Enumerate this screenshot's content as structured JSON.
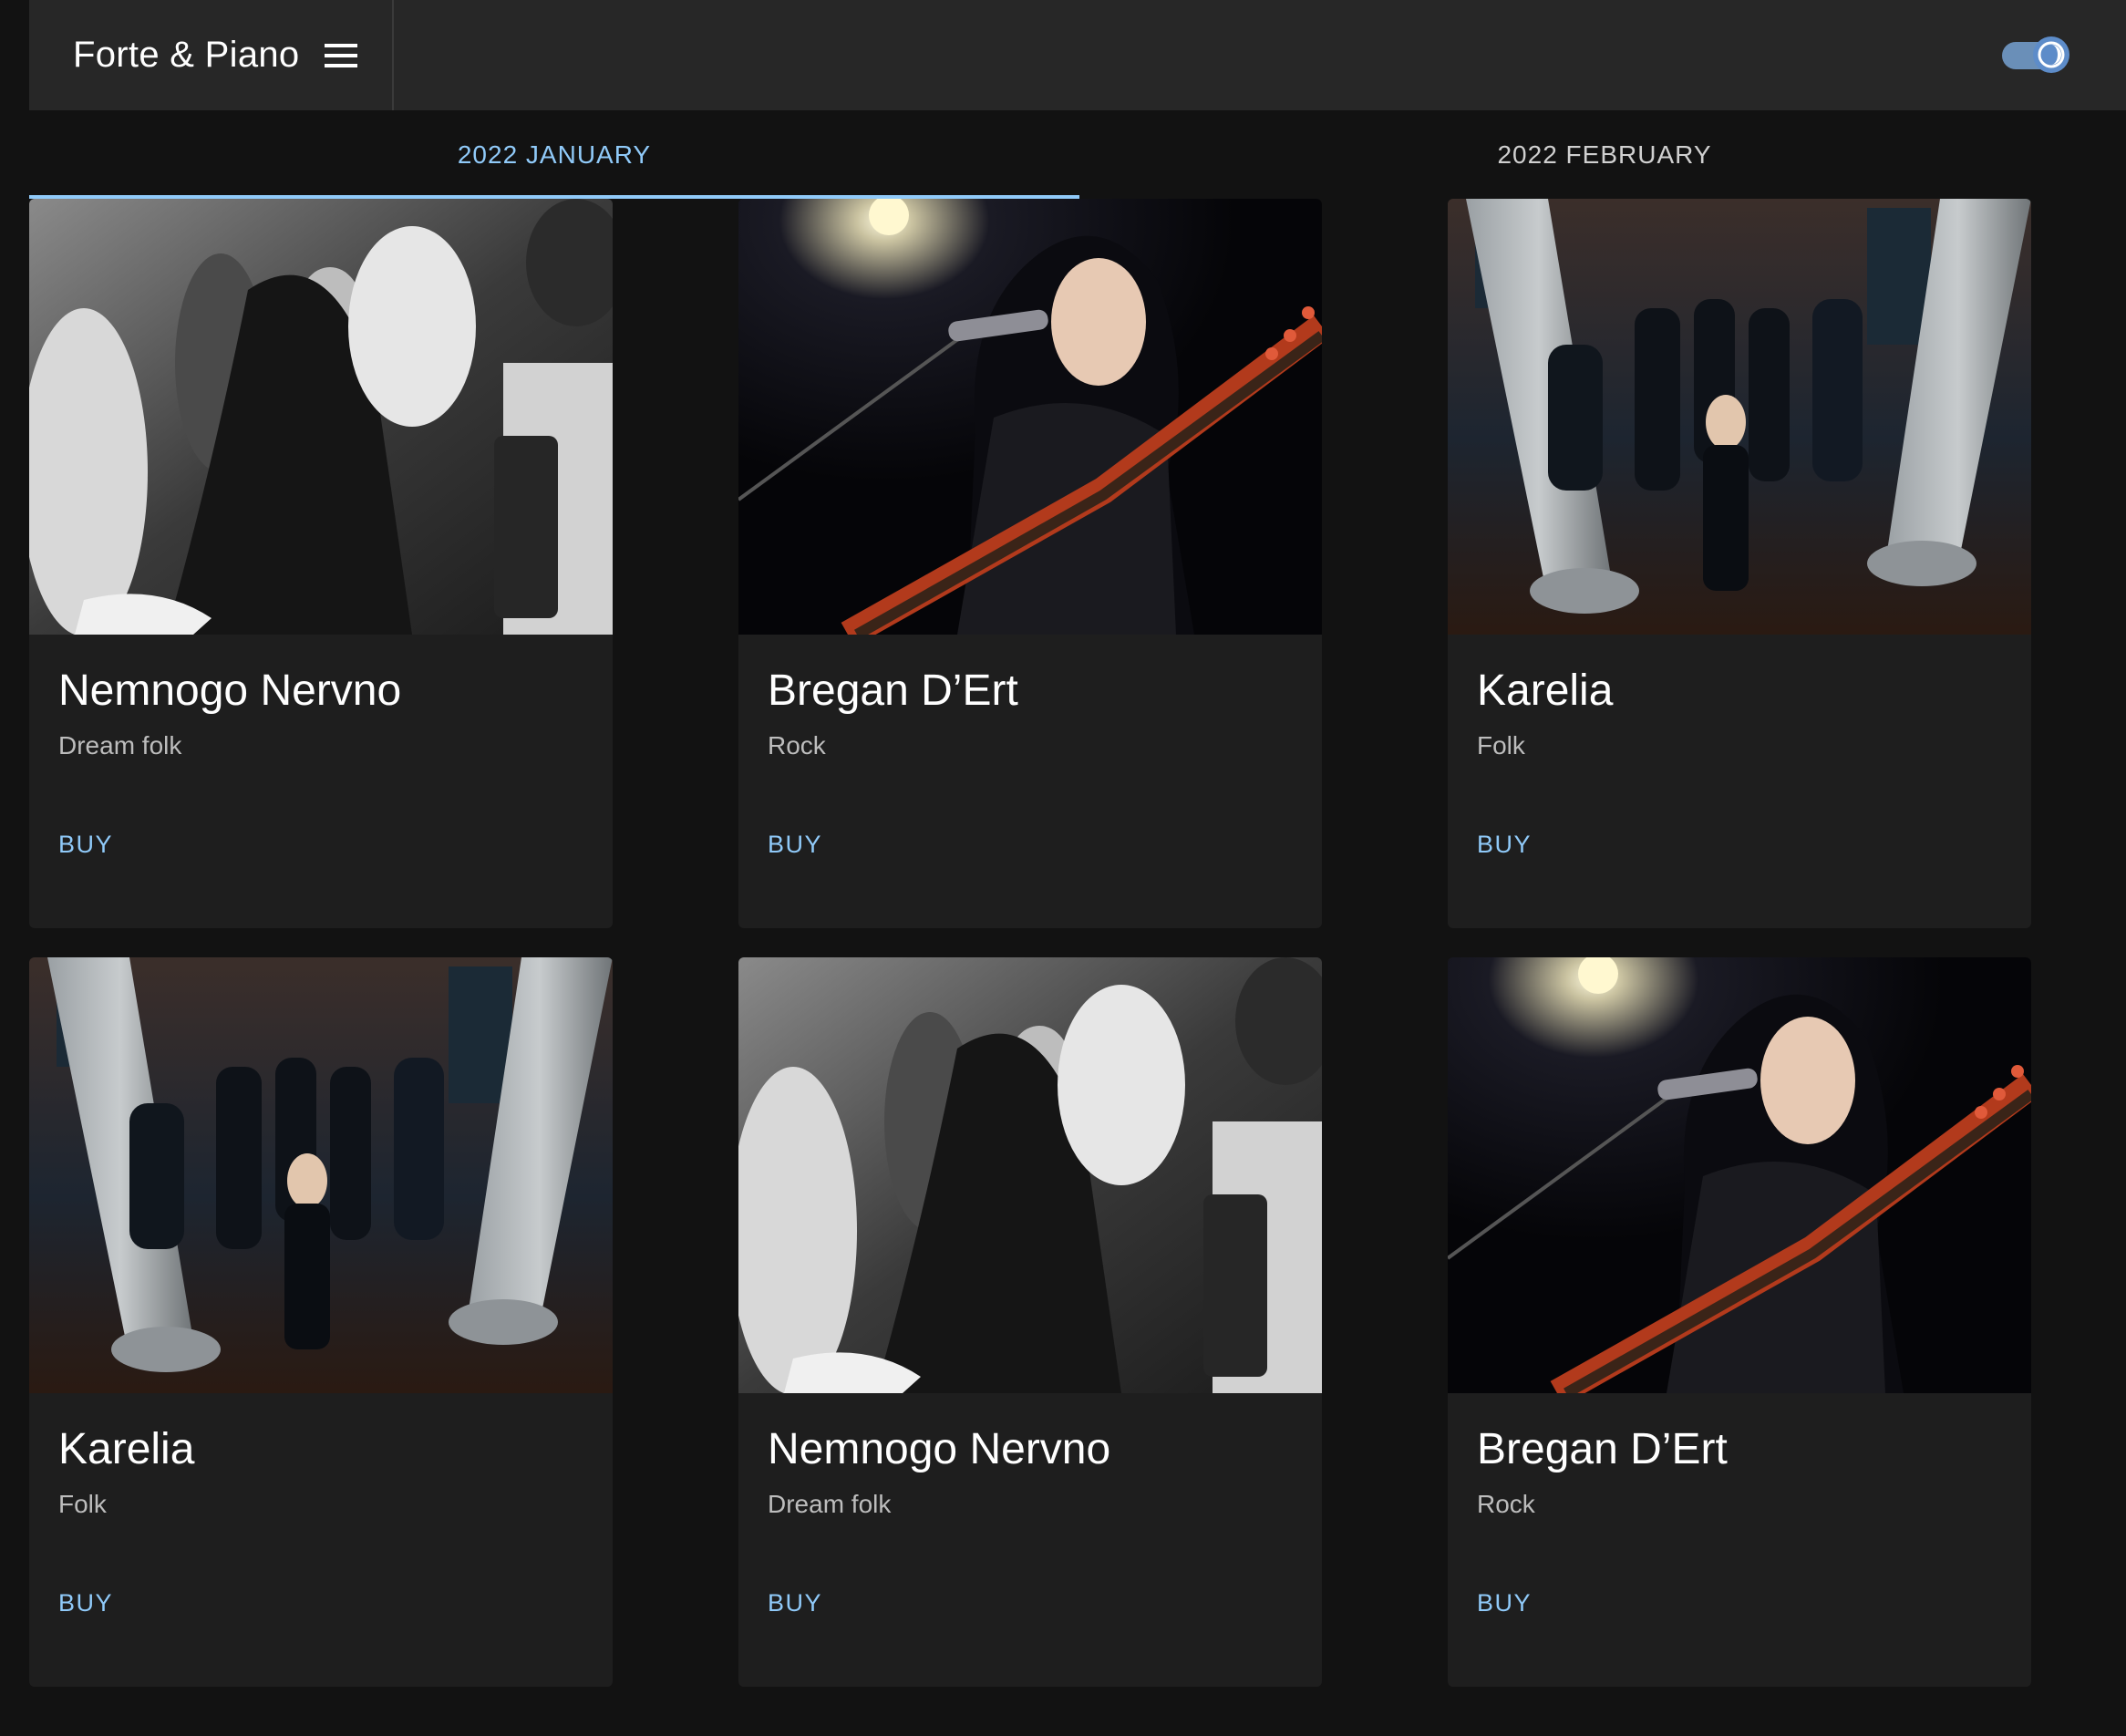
{
  "app": {
    "title": "Forte & Piano",
    "menu_icon": "menu-icon",
    "theme_toggle_icon": "dark-mode-icon"
  },
  "tabs": [
    {
      "label": "2022 JANUARY",
      "active": true
    },
    {
      "label": "2022 FEBRUARY",
      "active": false
    }
  ],
  "cards": [
    {
      "title": "Nemnogo Nervno",
      "genre": "Dream folk",
      "buy_label": "BUY",
      "photo": "band-group-bw-photo"
    },
    {
      "title": "Bregan D’Ert",
      "genre": "Rock",
      "buy_label": "BUY",
      "photo": "singer-with-guitar-photo"
    },
    {
      "title": "Karelia",
      "genre": "Folk",
      "buy_label": "BUY",
      "photo": "band-in-hall-photo"
    },
    {
      "title": "Karelia",
      "genre": "Folk",
      "buy_label": "BUY",
      "photo": "band-in-hall-photo"
    },
    {
      "title": "Nemnogo Nervno",
      "genre": "Dream folk",
      "buy_label": "BUY",
      "photo": "band-group-bw-photo"
    },
    {
      "title": "Bregan D’Ert",
      "genre": "Rock",
      "buy_label": "BUY",
      "photo": "singer-with-guitar-photo"
    }
  ],
  "colors": {
    "background": "#121212",
    "appbar": "#272727",
    "card": "#1e1e1e",
    "accent": "#90caf9"
  }
}
